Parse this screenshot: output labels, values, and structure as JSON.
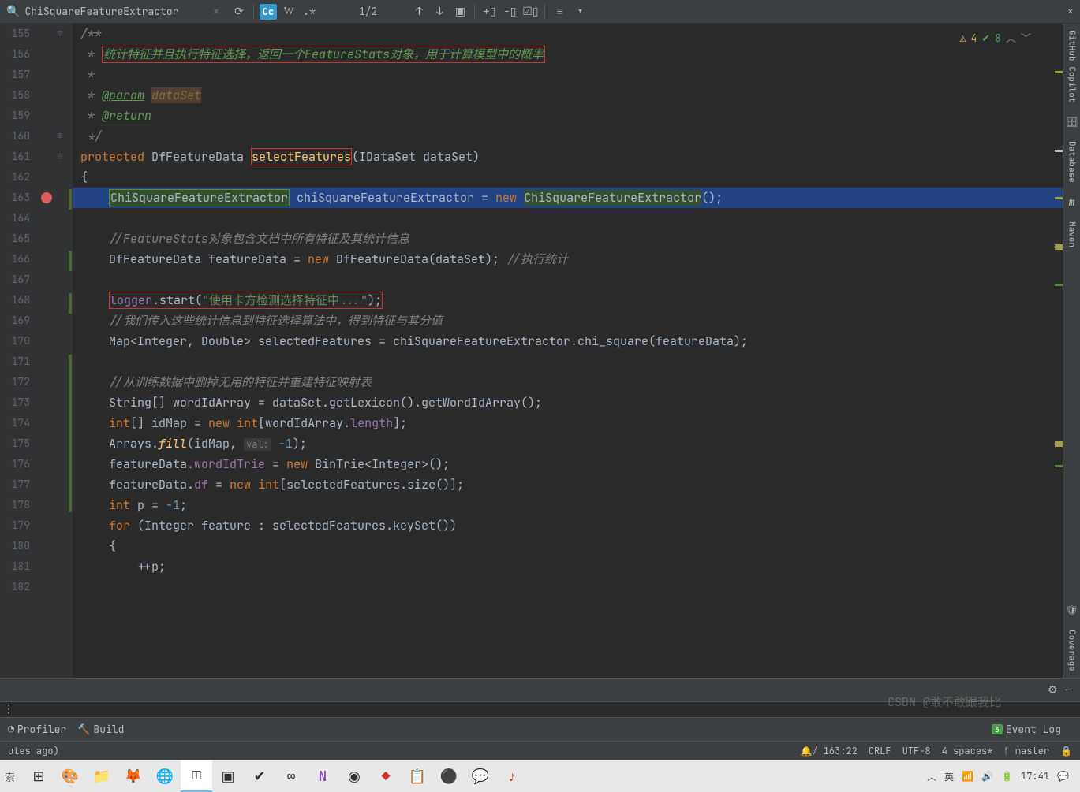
{
  "tab": {
    "search_query": "ChiSquareFeatureExtractor",
    "cc": "Cc",
    "w": "W",
    "count": "1/2"
  },
  "inspection": {
    "warn": "4",
    "ok": "8"
  },
  "gutter_start": 155,
  "bp_line": 163,
  "right": {
    "tabs": [
      "GitHub Copilot",
      "Database",
      "Maven",
      "Coverage"
    ]
  },
  "bottom": {
    "profiler": "Profiler",
    "build": "Build",
    "eventlog": "Event Log",
    "eventlog_badge": "3"
  },
  "status": {
    "left": "utes ago)",
    "pos": "163:22",
    "le": "CRLF",
    "enc": "UTF-8",
    "indent": "4 spaces*",
    "git": "master"
  },
  "taskbar": {
    "search": "索",
    "ime": "英",
    "time": "17:41"
  },
  "watermark": "CSDN @敢不敢跟我比",
  "lines": {
    "l155": "/**",
    "l156_pre": " * ",
    "l156_box": "统计特征并且执行特征选择，返回一个FeatureStats对象，用于计算模型中的概率",
    "l157": " *",
    "l158_pre": " * ",
    "l158_tag": "@param",
    "l158_p": "dataSet",
    "l159_pre": " * ",
    "l159_tag": "@return",
    "l160": " */",
    "l161_kw": "protected ",
    "l161_t": "DfFeatureData ",
    "l161_m": "selectFeatures",
    "l161_p": "(IDataSet dataSet)",
    "l162": "{",
    "l163_t1": "ChiSquareFeatureExtractor",
    "l163_v": " chiSquareFeatureExtractor = ",
    "l163_kw": "new ",
    "l163_t2": "ChiSquareFeatureExtractor",
    "l163_e": "();",
    "l165": "//FeatureStats对象包含文档中所有特征及其统计信息",
    "l166_a": "DfFeatureData featureData = ",
    "l166_kw": "new ",
    "l166_b": "DfFeatureData(dataSet); ",
    "l166_c": "//执行统计",
    "l168_f": "logger",
    "l168_a": ".start(",
    "l168_s": "\"使用卡方检测选择特征中...\"",
    "l168_e": ");",
    "l169": "//我们传入这些统计信息到特征选择算法中，得到特征与其分值",
    "l170_a": "Map<Integer, Double> ",
    "l170_v": "selectedFeatures",
    "l170_b": " = chiSquareFeatureExtractor.chi_square(featureData);",
    "l172": "//从训练数据中删掉无用的特征并重建特征映射表",
    "l173": "String[] wordIdArray = dataSet.getLexicon().getWordIdArray();",
    "l174_kw": "int",
    "l174_a": "[] idMap = ",
    "l174_kw2": "new int",
    "l174_b": "[wordIdArray.",
    "l174_f": "length",
    "l174_c": "];",
    "l175_a": "Arrays.",
    "l175_m": "fill",
    "l175_b": "(idMap, ",
    "l175_h": "val:",
    "l175_n": " -1",
    "l175_c": ");",
    "l176_a": "featureData.",
    "l176_f": "wordIdTrie",
    "l176_b": " = ",
    "l176_kw": "new ",
    "l176_c": "BinTrie<Integer>();",
    "l177_a": "featureData.",
    "l177_f": "df",
    "l177_b": " = ",
    "l177_kw": "new int",
    "l177_c": "[selectedFeatures.size()];",
    "l178_kw": "int ",
    "l178_a": "p = ",
    "l178_n": "-1",
    "l178_b": ";",
    "l179_kw": "for ",
    "l179_a": "(Integer feature : selectedFeatures.keySet())",
    "l180": "{",
    "l181": "++p;"
  }
}
